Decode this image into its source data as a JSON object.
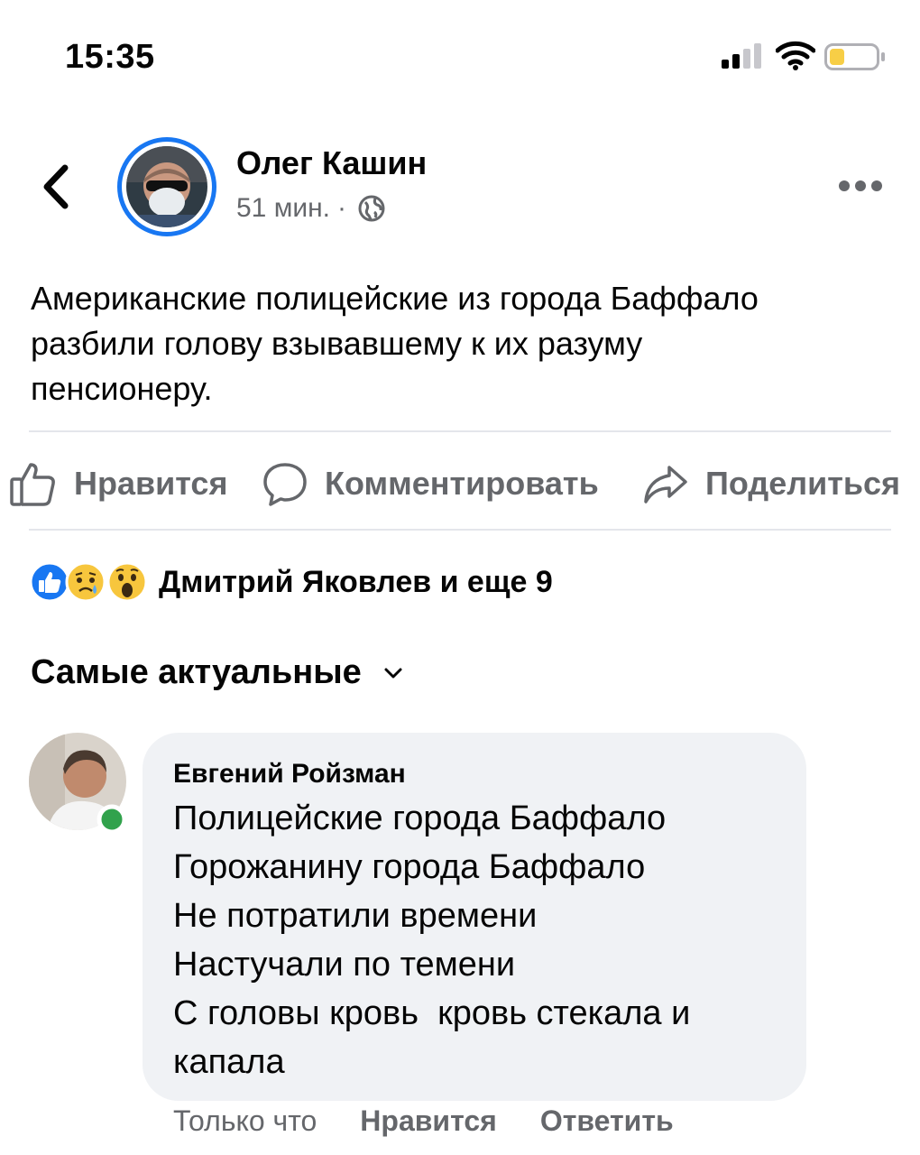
{
  "status_bar": {
    "time": "15:35",
    "icons": [
      "cellular-signal-icon",
      "wifi-icon",
      "battery-icon"
    ],
    "battery_color": "#f7ce46"
  },
  "header": {
    "back_icon": "chevron-left-icon",
    "author": "Олег Кашин",
    "time": "51 мин.",
    "separator": "·",
    "privacy_icon": "globe-icon",
    "more_icon": "ellipsis-icon"
  },
  "post": {
    "lines": [
      "Американские полицейские из города Баффало",
      "разбили голову взывавшему к их разуму",
      "пенсионеру."
    ]
  },
  "actions": {
    "like": "Нравится",
    "comment": "Комментировать",
    "share": "Поделиться"
  },
  "reactions": {
    "icons": [
      "like-reaction-icon",
      "sad-reaction-icon",
      "wow-reaction-icon"
    ],
    "summary": "Дмитрий Яковлев и еще 9"
  },
  "comments_sort": {
    "label": "Самые актуальные",
    "icon": "chevron-down-icon"
  },
  "comment": {
    "author": "Евгений Ройзман",
    "online": true,
    "lines": [
      "Полицейские города Баффало",
      "Горожанину города Баффало",
      "Не потратили времени",
      "Настучали по темени",
      "С головы кровь  кровь стекала и",
      "капала"
    ],
    "time": "Только что",
    "like": "Нравится",
    "reply": "Ответить"
  },
  "colors": {
    "accent": "#1877f2",
    "secondary_text": "#65676b",
    "bubble": "#f0f2f5",
    "online": "#31a24c"
  }
}
